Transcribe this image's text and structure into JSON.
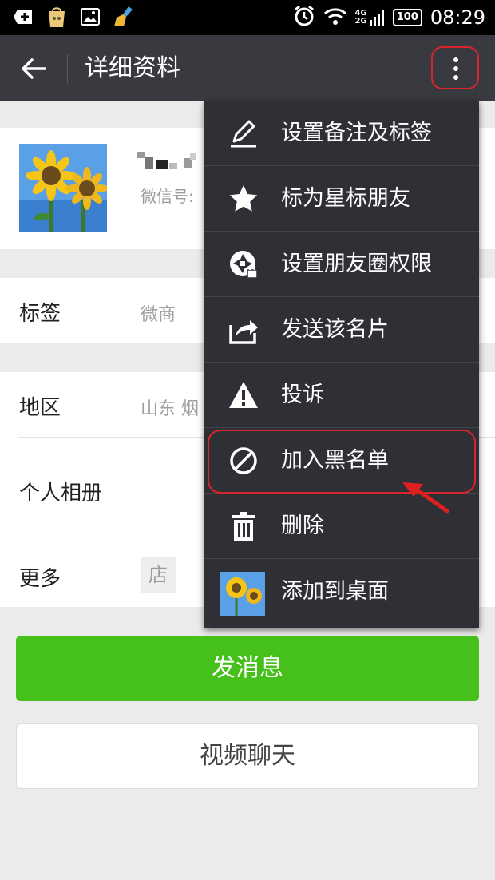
{
  "status_bar": {
    "network_top": "4G",
    "network_bottom": "2G",
    "battery": "100",
    "time": "08:29",
    "icons": [
      "add-box-icon",
      "photo-bag-icon",
      "image-icon",
      "broom-icon",
      "alarm-icon",
      "wifi-icon",
      "signal-icon",
      "battery-icon"
    ]
  },
  "header": {
    "title": "详细资料",
    "back_icon": "arrow-left-icon",
    "more_icon": "more-vertical-icon"
  },
  "profile": {
    "wechat_id_label": "微信号: "
  },
  "rows": [
    {
      "label": "标签",
      "value": "微商"
    },
    {
      "label": "地区",
      "value": "山东  烟"
    },
    {
      "label": "个人相册",
      "value": ""
    },
    {
      "label": "更多",
      "value": "店"
    }
  ],
  "buttons": {
    "send_message": "发消息",
    "video_call": "视频聊天"
  },
  "menu": {
    "items": [
      {
        "label": "设置备注及标签",
        "icon": "pencil-icon"
      },
      {
        "label": "标为星标朋友",
        "icon": "star-icon"
      },
      {
        "label": "设置朋友圈权限",
        "icon": "moments-lock-icon"
      },
      {
        "label": "发送该名片",
        "icon": "share-icon"
      },
      {
        "label": "投诉",
        "icon": "warning-icon"
      },
      {
        "label": "加入黑名单",
        "icon": "block-icon"
      },
      {
        "label": "删除",
        "icon": "trash-icon"
      },
      {
        "label": "添加到桌面",
        "icon": "sunflower-thumbnail-icon"
      }
    ]
  },
  "colors": {
    "app_bar": "#393a3f",
    "menu_bg": "#2f3035",
    "primary_button": "#46c01b",
    "highlight": "#d9252b"
  }
}
